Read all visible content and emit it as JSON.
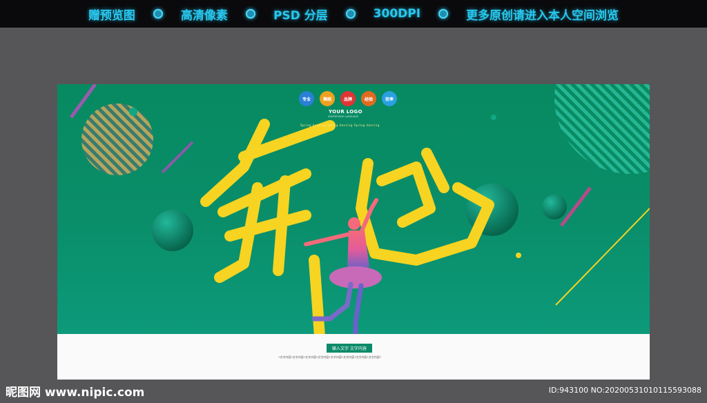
{
  "topbar": {
    "items": [
      "赠预览图",
      "高清像素",
      "PSD 分层",
      "300DPI",
      "更多原创请进入本人空间浏览"
    ]
  },
  "poster": {
    "badges": [
      {
        "label": "专业",
        "color": "#2a7fd6"
      },
      {
        "label": "舞蹈",
        "color": "#f0a020"
      },
      {
        "label": "品牌",
        "color": "#e23434"
      },
      {
        "label": "经验",
        "color": "#e06a20"
      },
      {
        "label": "效率",
        "color": "#2aa0e0"
      }
    ],
    "logo_text": "YOUR LOGO",
    "logo_sub": "ADVERTISING LANGUAGE",
    "tagline": "Spring dancing    Spring dancing    Spring dancing",
    "calligraphy": "舞蹈",
    "bottom_label": "输入文字  文字内容",
    "bottom_small": "•文字内容•文字内容•文字内容•文字内容•文字内容•文字内容•文字内容•文字内容•"
  },
  "footer": {
    "site": "昵图网 www.nipic.com",
    "id_text": "ID:943100 NO:20200531010115593088"
  },
  "colors": {
    "poster_green": "#0b8a62",
    "calligraphy_yellow": "#f6d421",
    "topbar_cyan": "#27c7ee"
  }
}
